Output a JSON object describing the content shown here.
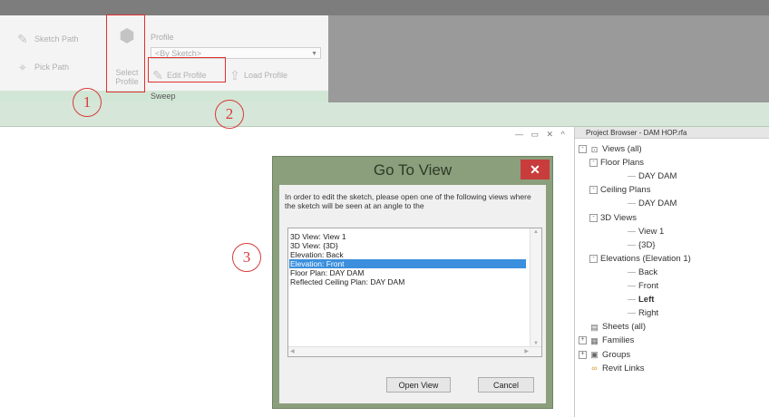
{
  "ribbon": {
    "sketch_path": "Sketch Path",
    "pick_path": "Pick Path",
    "select_profile_line1": "Select",
    "select_profile_line2": "Profile",
    "profile_label": "Profile",
    "profile_value": "<By Sketch>",
    "edit_profile": "Edit Profile",
    "load_profile": "Load Profile",
    "panel_name": "Sweep"
  },
  "callouts": [
    "1",
    "2",
    "3"
  ],
  "window_controls": "— ▭ ✕  ^",
  "project_browser": {
    "title": "Project Browser - DAM HOP.rfa",
    "items": [
      {
        "label": "Views (all)",
        "level": 0,
        "icon": "views-icon",
        "toggle": "-"
      },
      {
        "label": "Floor Plans",
        "level": 1,
        "toggle": "-"
      },
      {
        "label": "DAY DAM",
        "level": 2
      },
      {
        "label": "Ceiling Plans",
        "level": 1,
        "toggle": "-"
      },
      {
        "label": "DAY DAM",
        "level": 2
      },
      {
        "label": "3D Views",
        "level": 1,
        "toggle": "-"
      },
      {
        "label": "View 1",
        "level": 2
      },
      {
        "label": "{3D}",
        "level": 2
      },
      {
        "label": "Elevations (Elevation 1)",
        "level": 1,
        "toggle": "-"
      },
      {
        "label": "Back",
        "level": 2
      },
      {
        "label": "Front",
        "level": 2
      },
      {
        "label": "Left",
        "level": 2,
        "bold": true
      },
      {
        "label": "Right",
        "level": 2
      },
      {
        "label": "Sheets (all)",
        "level": 0,
        "icon": "sheets-icon"
      },
      {
        "label": "Families",
        "level": 0,
        "icon": "families-icon",
        "toggle": "+"
      },
      {
        "label": "Groups",
        "level": 0,
        "icon": "groups-icon",
        "toggle": "+"
      },
      {
        "label": "Revit Links",
        "level": 0,
        "icon": "revit-links-icon"
      }
    ]
  },
  "dialog": {
    "title": "Go To View",
    "close_glyph": "✕",
    "message": "In order to edit the sketch, please open one of the following views where the sketch will be seen at an angle to the",
    "options": [
      "3D View: View 1",
      "3D View: {3D}",
      "Elevation: Back",
      "Elevation: Front",
      "Floor Plan: DAY DAM",
      "Reflected Ceiling Plan: DAY DAM"
    ],
    "selected_index": 3,
    "open_view": "Open View",
    "cancel": "Cancel"
  },
  "colors": {
    "dialog_frame": "#8b9f7d",
    "selection": "#3b8fdd",
    "callout": "#d83a3a",
    "close_button": "#c83c3c"
  }
}
